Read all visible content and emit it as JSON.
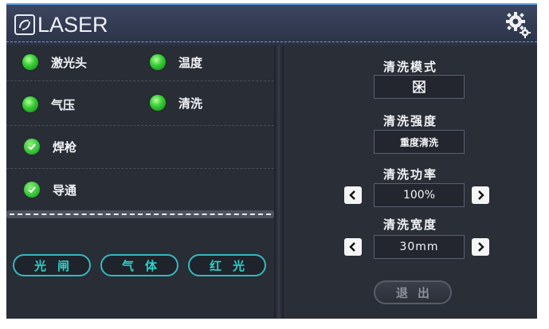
{
  "header": {
    "logo_text": "LASER"
  },
  "status": {
    "indicators": [
      {
        "label": "激光头",
        "state": "on",
        "icon": "green-led-icon"
      },
      {
        "label": "温度",
        "state": "on",
        "icon": "green-led-icon"
      },
      {
        "label": "气压",
        "state": "on",
        "icon": "green-led-icon"
      },
      {
        "label": "清洗",
        "state": "on",
        "icon": "green-led-icon"
      },
      {
        "label": "焊枪",
        "state": "ok",
        "icon": "check-circle-icon"
      },
      {
        "label": "导通",
        "state": "ok",
        "icon": "check-circle-icon"
      }
    ]
  },
  "buttons": {
    "light_gate": "光闸",
    "gas": "气体",
    "red_light": "红光",
    "exit": "退出"
  },
  "settings": {
    "mode": {
      "title": "清洗模式",
      "icon": "mode-pattern-icon"
    },
    "intensity": {
      "title": "清洗强度",
      "value": "重度清洗"
    },
    "power": {
      "title": "清洗功率",
      "value": "100%"
    },
    "width": {
      "title": "清洗宽度",
      "value": "30mm"
    }
  },
  "colors": {
    "background": "#232730",
    "accent_cyan": "#34b8c0",
    "led_green": "#3ad13a",
    "header_top": "#5fa6ef"
  }
}
